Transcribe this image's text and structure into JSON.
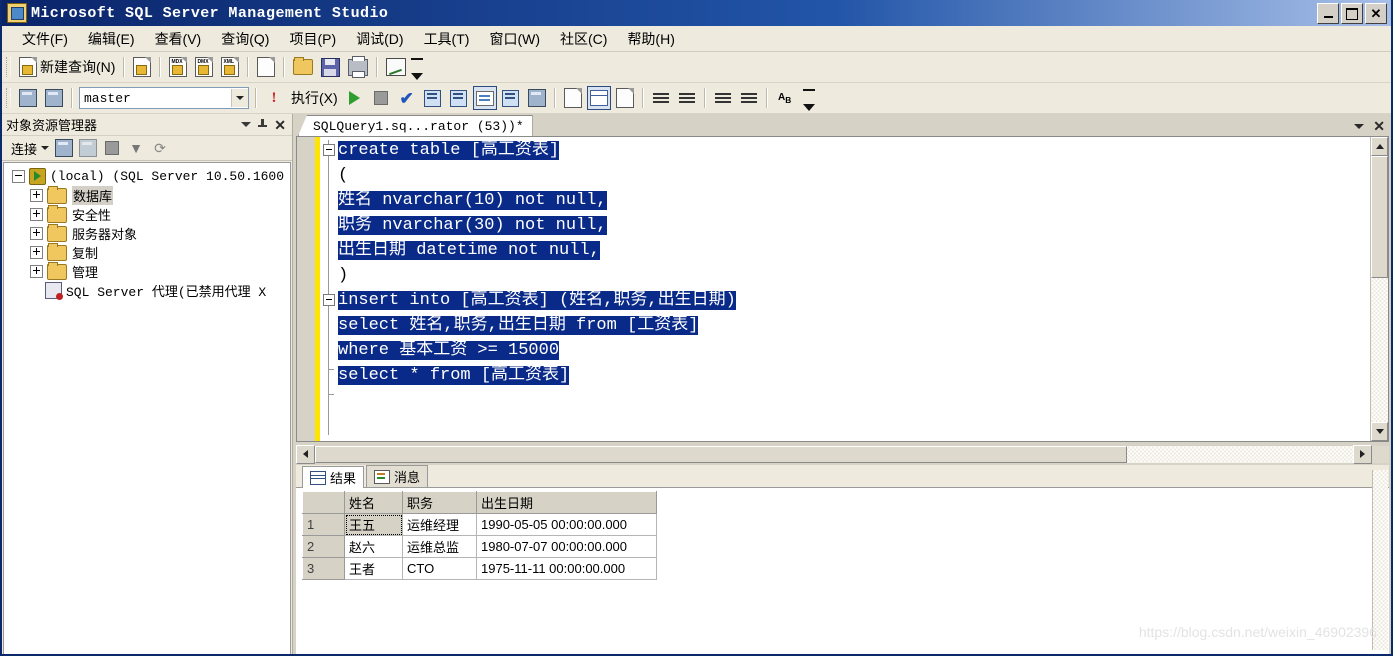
{
  "window": {
    "title": "Microsoft SQL Server Management Studio",
    "icon": "ssms-app-icon",
    "buttons": {
      "minimize": "_",
      "maximize": "□",
      "close": "✕"
    }
  },
  "menubar": {
    "items": [
      {
        "label": "文件(F)",
        "name": "menu-file"
      },
      {
        "label": "编辑(E)",
        "name": "menu-edit"
      },
      {
        "label": "查看(V)",
        "name": "menu-view"
      },
      {
        "label": "查询(Q)",
        "name": "menu-query"
      },
      {
        "label": "项目(P)",
        "name": "menu-project"
      },
      {
        "label": "调试(D)",
        "name": "menu-debug"
      },
      {
        "label": "工具(T)",
        "name": "menu-tools"
      },
      {
        "label": "窗口(W)",
        "name": "menu-window"
      },
      {
        "label": "社区(C)",
        "name": "menu-community"
      },
      {
        "label": "帮助(H)",
        "name": "menu-help"
      }
    ]
  },
  "toolbar_standard": {
    "new_query_label": "新建查询(N)",
    "icons": [
      "new-query-icon",
      "new-database-engine-query-icon",
      "new-mdx-query-icon",
      "new-dmx-query-icon",
      "new-xmla-query-icon",
      "new-file-icon",
      "open-file-icon",
      "save-icon",
      "print-icon",
      "analyze-query-icon"
    ]
  },
  "toolbar_sql_editor": {
    "database": "master",
    "execute_label": "执行(X)",
    "icons": [
      "connect-icon",
      "disconnect-icon",
      "exclamation-icon",
      "execute-play-icon",
      "stop-icon",
      "parse-check-icon",
      "display-estimated-plan-icon",
      "query-options-icon",
      "include-actual-plan-icon",
      "include-client-statistics-icon",
      "results-to-text-icon",
      "results-to-grid-icon",
      "results-to-file-icon",
      "comment-lines-icon",
      "uncomment-lines-icon",
      "decrease-indent-icon",
      "increase-indent-icon",
      "find-replace-icon"
    ]
  },
  "object_explorer": {
    "panel_title": "对象资源管理器",
    "connect_label": "连接",
    "toolbar_icons": [
      "connect-icon",
      "disconnect-icon",
      "stop-icon",
      "filter-icon",
      "refresh-icon"
    ],
    "header_icons": [
      "chevron-down-icon",
      "pin-icon",
      "close-icon"
    ],
    "tree": [
      {
        "label": "(local) (SQL Server 10.50.1600",
        "icon": "server-icon",
        "expander": "minus",
        "indent": 0,
        "selected": false
      },
      {
        "label": "数据库",
        "icon": "folder-icon",
        "expander": "plus",
        "indent": 1,
        "selected": true
      },
      {
        "label": "安全性",
        "icon": "folder-icon",
        "expander": "plus",
        "indent": 1,
        "selected": false
      },
      {
        "label": "服务器对象",
        "icon": "folder-icon",
        "expander": "plus",
        "indent": 1,
        "selected": false
      },
      {
        "label": "复制",
        "icon": "folder-icon",
        "expander": "plus",
        "indent": 1,
        "selected": false
      },
      {
        "label": "管理",
        "icon": "folder-icon",
        "expander": "plus",
        "indent": 1,
        "selected": false
      },
      {
        "label": "SQL Server 代理(已禁用代理 X",
        "icon": "agent-icon",
        "expander": "none",
        "indent": 1,
        "selected": false
      }
    ]
  },
  "editor": {
    "tab_title": "SQLQuery1.sq...rator (53))*",
    "right_icons": [
      "chevron-down-icon",
      "close-icon"
    ],
    "code_lines": [
      {
        "text": "create table [高工资表]",
        "selected": true,
        "fold": "start"
      },
      {
        "text": "(",
        "selected": false,
        "fold": "line"
      },
      {
        "text": "姓名 nvarchar(10) not null,",
        "selected": true,
        "fold": "line"
      },
      {
        "text": "职务 nvarchar(30) not null,",
        "selected": true,
        "fold": "line"
      },
      {
        "text": "出生日期 datetime not null,",
        "selected": true,
        "fold": "line"
      },
      {
        "text": ")",
        "selected": false,
        "fold": "line"
      },
      {
        "text": "insert into [高工资表] (姓名,职务,出生日期)",
        "selected": true,
        "fold": "start"
      },
      {
        "text": "select 姓名,职务,出生日期 from [工资表]",
        "selected": true,
        "fold": "line"
      },
      {
        "text": "where 基本工资 >= 15000",
        "selected": true,
        "fold": "start"
      },
      {
        "text": "select * from [高工资表]",
        "selected": true,
        "fold": "end"
      }
    ]
  },
  "results": {
    "tabs": [
      {
        "label": "结果",
        "icon": "grid-icon",
        "active": true
      },
      {
        "label": "消息",
        "icon": "message-icon",
        "active": false
      }
    ],
    "columns": [
      "",
      "姓名",
      "职务",
      "出生日期"
    ],
    "rows": [
      {
        "num": "1",
        "姓名": "王五",
        "职务": "运维经理",
        "出生日期": "1990-05-05 00:00:00.000"
      },
      {
        "num": "2",
        "姓名": "赵六",
        "职务": "运维总监",
        "出生日期": "1980-07-07 00:00:00.000"
      },
      {
        "num": "3",
        "姓名": "王者",
        "职务": "CTO",
        "出生日期": "1975-11-11 00:00:00.000"
      }
    ]
  },
  "watermark": "https://blog.csdn.net/weixin_46902396",
  "colors": {
    "titlebar": "#0a246a",
    "selection": "#0a2a8a",
    "toolbar_bg": "#eeeade",
    "window_bg": "#d6d2c6",
    "change_bar": "#ffe400"
  }
}
